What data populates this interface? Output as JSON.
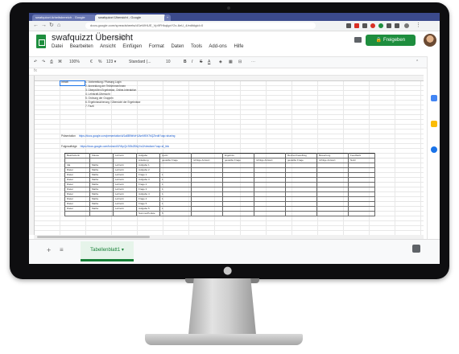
{
  "browser": {
    "tabs": [
      {
        "label": "swafquizzt Arbeitsbereich - Google"
      },
      {
        "label": "swafquizzt Übersicht - Google"
      }
    ],
    "url": "docs.google.com/spreadsheets/d/1eWHUE_Vp9FHkqlgxY2x-6eU_4/edit#gid=0"
  },
  "doc": {
    "title": "swafquizzt Übersicht",
    "menu": [
      "Datei",
      "Bearbeiten",
      "Ansicht",
      "Einfügen",
      "Format",
      "Daten",
      "Tools",
      "Add-ons",
      "Hilfe"
    ],
    "share_label": "Freigeben"
  },
  "toolbar": {
    "zoom": "100%",
    "format": "123 ▾",
    "font": "Standard (...",
    "font_size": "10"
  },
  "sheet": {
    "a1": "Inhalt",
    "toc": [
      "1. Vorbereitung / Planung Login",
      "2. Anmeldung der Teilnehmer/innen",
      "3. Überprüfen Ergebnisse, Online-Interaktion",
      "4. Lehrkraft-Übersicht",
      "5. Ordnung der Gruppen",
      "6. Ergebnissicherung / Übersicht der Ergebnisse",
      "7. Fazit"
    ],
    "links": [
      {
        "label": "Präsentation",
        "url": "https://docs.google.com/presentation/d/1a8B9bKeHJAmN9Xt7bQZ/edit?usp=sharing"
      },
      {
        "label": "Folgeaufträge",
        "url": "https://docs.google.com/forms/d/1FAIpQLSf3kZ8XqYw2/viewform?usp=sf_link"
      }
    ],
    "table": {
      "header": [
        "Bearbeiterin",
        "Klasse",
        "Lehrerin",
        "Aufgabe",
        "Quizz",
        "",
        "Ergebnis",
        "",
        "Rechercheauftrag",
        "Bewertung",
        "Feedback"
      ],
      "subheader": [
        "",
        "",
        "",
        "Anleitung",
        "gestellte Frage",
        "richtige Antwort",
        "gestellte Frage",
        "richtige Antwort",
        "gestellte Frage",
        "richtige Antwort",
        "Notiz"
      ],
      "rows": [
        [
          "Ida",
          "Mathe",
          "Lehrerin",
          "Aufgabe 1",
          "",
          "",
          "",
          "",
          "",
          "",
          ""
        ],
        [
          "Dieter",
          "Mathe",
          "Lehrerin",
          "Aufgabe 2",
          "",
          "",
          "",
          "",
          "",
          "",
          ""
        ],
        [
          "Dieter",
          "Mathe",
          "Lehrerin",
          "Frage 1",
          "1",
          "",
          "",
          "",
          "",
          "",
          ""
        ],
        [
          "Dieter",
          "Mathe",
          "Lehrerin",
          "Aufgabe 3",
          "1",
          "",
          "",
          "",
          "",
          "",
          ""
        ],
        [
          "Dieter",
          "Mathe",
          "Lehrerin",
          "Frage 2",
          "1",
          "",
          "",
          "",
          "",
          "",
          ""
        ],
        [
          "Dieter",
          "Mathe",
          "Lehrerin",
          "Frage 3",
          "1",
          "",
          "",
          "",
          "",
          "",
          ""
        ],
        [
          "Dieter",
          "Mathe",
          "Lehrerin",
          "Aufgabe 4",
          "1",
          "",
          "",
          "",
          "",
          "",
          ""
        ],
        [
          "Dieter",
          "Mathe",
          "Lehrerin",
          "Frage 4",
          "1",
          "",
          "",
          "",
          "",
          "",
          ""
        ],
        [
          "Dieter",
          "Mathe",
          "Lehrerin",
          "Frage 5",
          "1",
          "",
          "",
          "",
          "",
          "",
          ""
        ],
        [
          "Dieter",
          "Mathe",
          "Lehrerin",
          "Aufgabe 5",
          "1",
          "",
          "",
          "",
          "",
          "",
          ""
        ],
        [
          "",
          "",
          "",
          "Summe/Punkte",
          "5",
          "",
          "",
          "",
          "",
          "",
          ""
        ]
      ]
    },
    "tab_label": "Tabellenblatt1"
  },
  "colors": {
    "sheets_green": "#1e8e3e",
    "chrome_tab": "#3b4a8c",
    "link": "#1155cc"
  }
}
